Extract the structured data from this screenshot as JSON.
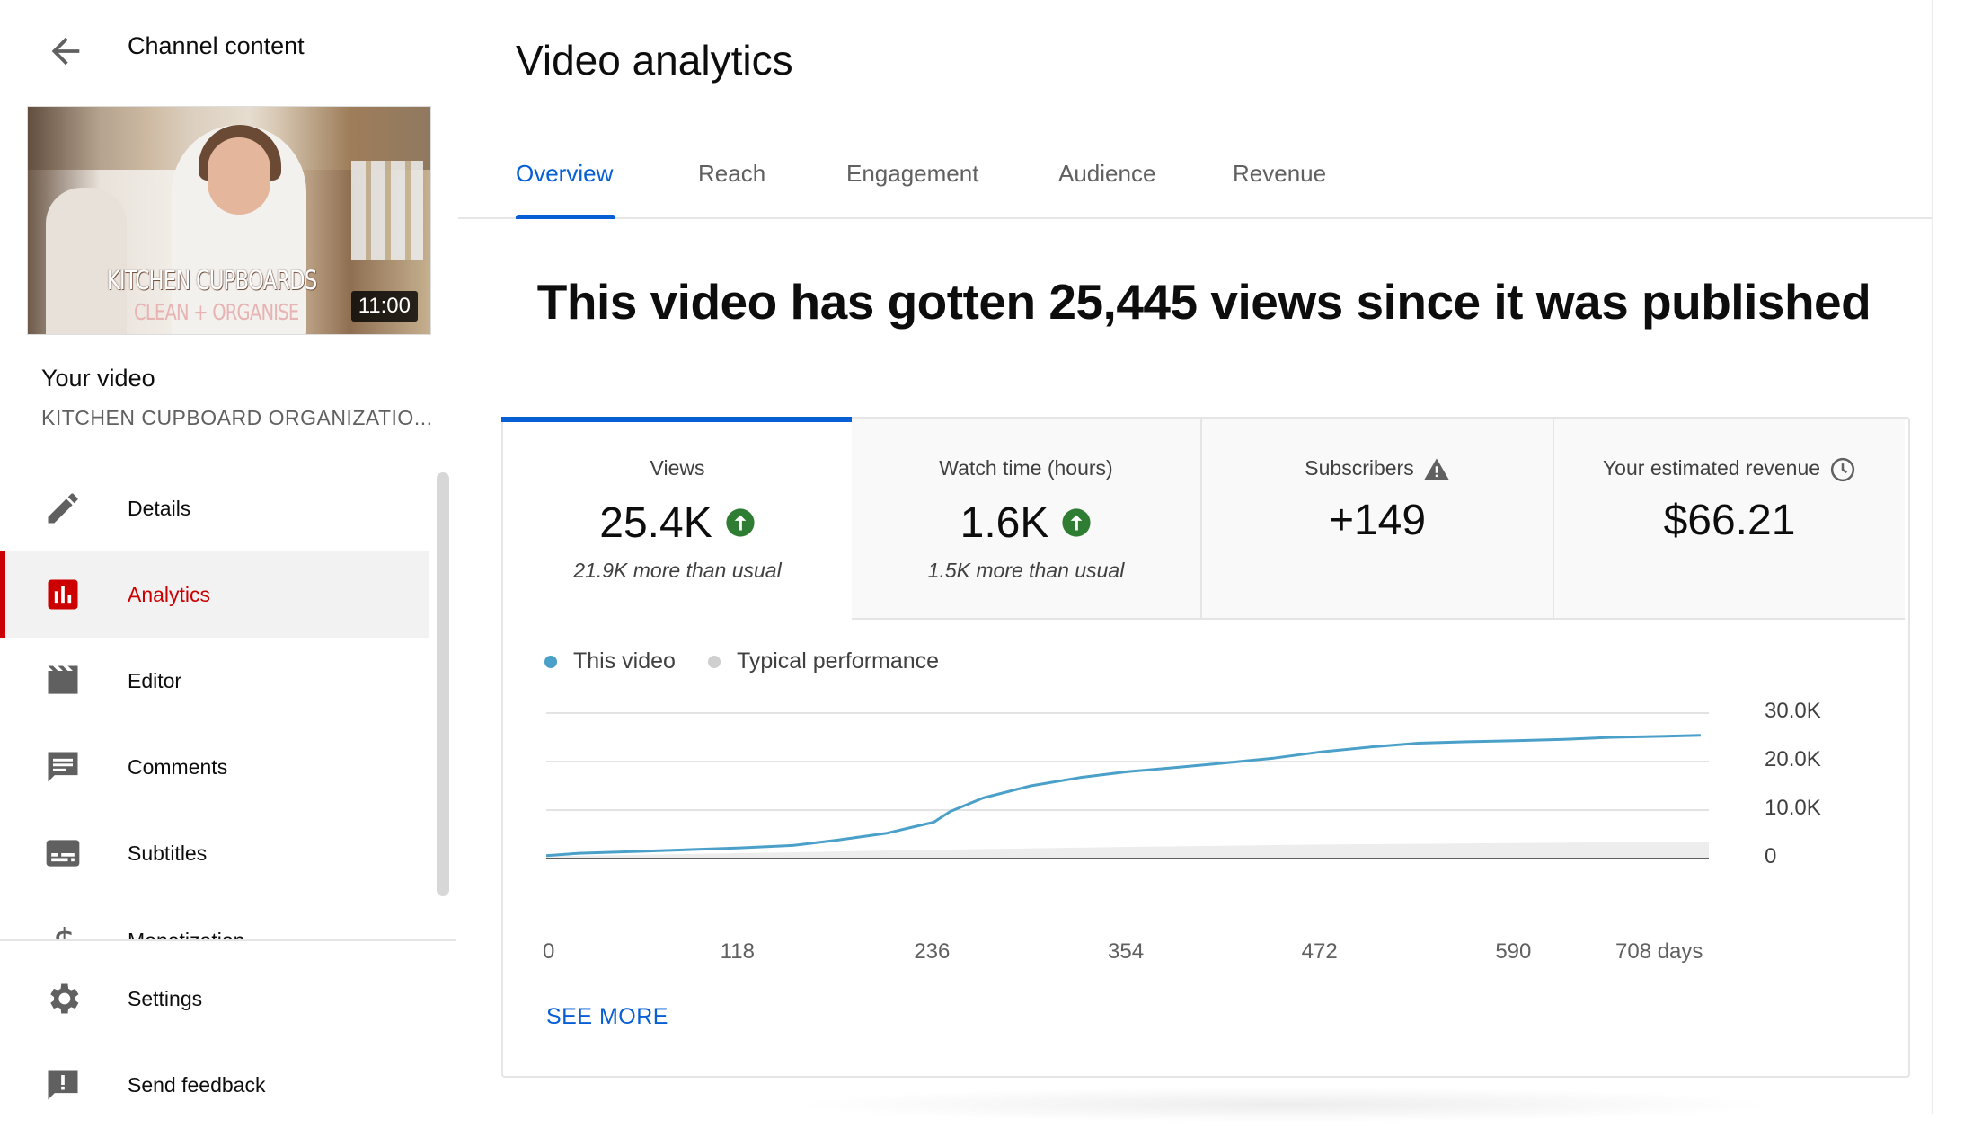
{
  "sidebar": {
    "back_label": "Channel content",
    "thumbnail": {
      "title_line1": "KITCHEN CUPBOARDS",
      "title_line2": "CLEAN + ORGANISE",
      "duration": "11:00"
    },
    "your_video_label": "Your video",
    "video_title": "KITCHEN CUPBOARD ORGANIZATIO...",
    "items": [
      {
        "label": "Details",
        "icon": "pencil-icon",
        "active": false
      },
      {
        "label": "Analytics",
        "icon": "analytics-icon",
        "active": true
      },
      {
        "label": "Editor",
        "icon": "clapperboard-icon",
        "active": false
      },
      {
        "label": "Comments",
        "icon": "comment-icon",
        "active": false
      },
      {
        "label": "Subtitles",
        "icon": "subtitles-icon",
        "active": false
      },
      {
        "label": "Monetization",
        "icon": "dollar-icon",
        "active": false
      }
    ],
    "bottom_items": [
      {
        "label": "Settings",
        "icon": "gear-icon"
      },
      {
        "label": "Send feedback",
        "icon": "feedback-icon"
      }
    ]
  },
  "main": {
    "title": "Video analytics",
    "tabs": [
      {
        "label": "Overview",
        "active": true
      },
      {
        "label": "Reach",
        "active": false
      },
      {
        "label": "Engagement",
        "active": false
      },
      {
        "label": "Audience",
        "active": false
      },
      {
        "label": "Revenue",
        "active": false
      }
    ],
    "headline": "This video has gotten 25,445 views since it was published",
    "metrics": [
      {
        "label": "Views",
        "value": "25.4K",
        "trend_icon": "arrow-up-circle-icon",
        "sub": "21.9K more than usual"
      },
      {
        "label": "Watch time (hours)",
        "value": "1.6K",
        "trend_icon": "arrow-up-circle-icon",
        "sub": "1.5K more than usual"
      },
      {
        "label": "Subscribers",
        "value": "+149",
        "label_icon": "warning-icon"
      },
      {
        "label": "Your estimated revenue",
        "value": "$66.21",
        "label_icon": "clock-icon"
      }
    ],
    "see_more": "SEE MORE"
  },
  "colors": {
    "accent": "#065fd4",
    "active_nav": "#cc0000",
    "up_green": "#2e7d32",
    "line": "#4aa0c8",
    "typical": "#cfcfcf"
  },
  "chart_data": {
    "type": "line",
    "legend": [
      "This video",
      "Typical performance"
    ],
    "x_tick_labels": [
      "0",
      "118",
      "236",
      "354",
      "472",
      "590",
      "708 days"
    ],
    "y_tick_labels": [
      "30.0K",
      "20.0K",
      "10.0K",
      "0"
    ],
    "xlim": [
      0,
      708
    ],
    "ylim": [
      0,
      30000
    ],
    "grid": true,
    "series": [
      {
        "name": "This video",
        "x": [
          0,
          20,
          59,
          118,
          150,
          177,
          207,
          236,
          246,
          266,
          295,
          325,
          354,
          384,
          413,
          443,
          472,
          502,
          531,
          561,
          590,
          620,
          649,
          679,
          703
        ],
        "y": [
          600,
          1100,
          1500,
          2200,
          2700,
          3800,
          5200,
          7500,
          9700,
          12500,
          15000,
          16700,
          17900,
          18800,
          19700,
          20700,
          22000,
          23000,
          23800,
          24100,
          24300,
          24600,
          25000,
          25200,
          25400
        ]
      },
      {
        "name": "Typical performance",
        "x": [
          0,
          118,
          236,
          354,
          472,
          590,
          708
        ],
        "y_low": [
          0,
          0,
          0,
          0,
          0,
          0,
          0
        ],
        "y_high": [
          500,
          1100,
          1800,
          2400,
          2900,
          3200,
          3500
        ]
      }
    ]
  }
}
